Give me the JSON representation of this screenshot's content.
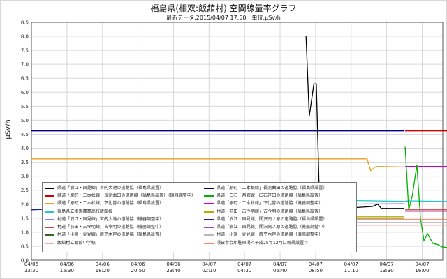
{
  "chart_data": {
    "type": "line",
    "title": "福島県(相双:飯舘村) 空間線量率グラフ",
    "subtitle": "最新データ:2015/04/07 17:50　単位:μSv/h",
    "ylabel": "μSv/h",
    "xlabel": "",
    "ylim": [
      0,
      8.5
    ],
    "yticks": [
      "0.0",
      "0.5",
      "1.0",
      "1.5",
      "2.0",
      "2.5",
      "3.0",
      "3.5",
      "4.0",
      "4.5",
      "5.0",
      "5.5",
      "6.0",
      "6.5",
      "7.0",
      "7.5",
      "8.0",
      "8.5"
    ],
    "xticks": [
      {
        "date": "04/06",
        "time": "13:30"
      },
      {
        "date": "04/06",
        "time": "15:30"
      },
      {
        "date": "04/06",
        "time": "18:20"
      },
      {
        "date": "04/06",
        "time": "20:50"
      },
      {
        "date": "04/06",
        "time": "23:40"
      },
      {
        "date": "04/07",
        "time": "02:10"
      },
      {
        "date": "04/07",
        "time": "04:30"
      },
      {
        "date": "04/07",
        "time": "06:40"
      },
      {
        "date": "04/07",
        "time": "08:50"
      },
      {
        "date": "04/07",
        "time": "11:10"
      },
      {
        "date": "04/07",
        "time": "13:30"
      },
      {
        "date": "04/07",
        "time": "16:00"
      }
    ],
    "grid": true,
    "legend_position": "bottom-left",
    "legend": [
      {
        "label": "県道「浪江・国見線」宮内大池の道路脇（福島県設置）",
        "color": "#000000"
      },
      {
        "label": "県道「原町・二本松線」長泥曲田の道路脇（福島県設置）",
        "color": "#000080"
      },
      {
        "label": "県道「原町・二本松線」長泥曲田の道路脇（福島県設置）（機器調整中）",
        "color": "#cc0000"
      },
      {
        "label": "県道「白石・月舘線」臼石笹田の道路脇（福島県設置）",
        "color": "#00b000"
      },
      {
        "label": "県道「原町・二本松線」下比曽の道路脇（福島県設置）",
        "color": "#e8a020"
      },
      {
        "label": "県道「原町・二本松線」下比曽の道路脇（機器調整中）",
        "color": "#cc00cc"
      },
      {
        "label": "福島県立相馬農業高校飯舘校",
        "color": "#20c8c8"
      },
      {
        "label": "村道「前田・古今明線」古今明の道路脇（福島県設置）",
        "color": "#b0b000"
      },
      {
        "label": "村道「浪江・国見線」宮内大池の道路脇（機器調整中）",
        "color": "#8080ff"
      },
      {
        "label": "県道「浪江・国見線」関沢南ノ原の道路脇（福島県設置）",
        "color": "#2020a0"
      },
      {
        "label": "村道「前田・古今明線」古今明の道路脇（機器調整中）",
        "color": "#d04040"
      },
      {
        "label": "県道「浪江・国見線」関沢南ノ原の道路脇（機器調整中）",
        "color": "#a040d0"
      },
      {
        "label": "村道「小宮・夏見線」蕨平木戸の道路脇（福島県設置）",
        "color": "#406020"
      },
      {
        "label": "村道「小宮・夏見線」蕨平木戸の道路脇（機器調整中）",
        "color": "#b8b8b8"
      },
      {
        "label": "飯舘村立飯舘中学校",
        "color": "#ffaaaa"
      },
      {
        "label": "浸日参会所駐車場＜平成25年12月に新規設置＞",
        "color": "#ff8060"
      }
    ],
    "series": [
      {
        "color": "#000080",
        "points": [
          [
            0,
            4.62
          ],
          [
            10.5,
            4.62
          ]
        ]
      },
      {
        "color": "#cc0000",
        "points": [
          [
            10.52,
            4.62
          ],
          [
            11.7,
            4.62
          ]
        ]
      },
      {
        "color": "#e8a020",
        "points": [
          [
            0,
            3.62
          ],
          [
            9.45,
            3.62
          ],
          [
            9.55,
            3.2
          ],
          [
            9.7,
            3.35
          ],
          [
            10.5,
            3.33
          ]
        ]
      },
      {
        "color": "#cc00cc",
        "points": [
          [
            10.52,
            3.35
          ],
          [
            11.7,
            3.35
          ]
        ]
      },
      {
        "color": "#000000",
        "points": [
          [
            7.73,
            8.0
          ],
          [
            7.82,
            5.15
          ],
          [
            7.95,
            6.3
          ],
          [
            8.02,
            6.3
          ],
          [
            8.1,
            2.5
          ],
          [
            8.3,
            1.85
          ],
          [
            9.0,
            1.87
          ],
          [
            9.6,
            1.92
          ],
          [
            9.75,
            2.0
          ],
          [
            9.85,
            1.85
          ],
          [
            10.5,
            1.85
          ]
        ]
      },
      {
        "color": "#20c8c8",
        "points": [
          [
            8.2,
            2.15
          ],
          [
            10.5,
            2.1
          ],
          [
            10.6,
            2.12
          ],
          [
            11.7,
            2.1
          ]
        ]
      },
      {
        "color": "#00b000",
        "points": [
          [
            10.52,
            4.05
          ],
          [
            10.62,
            1.8
          ],
          [
            10.72,
            2.3
          ],
          [
            10.85,
            3.4
          ],
          [
            10.95,
            1.5
          ],
          [
            11.05,
            0.7
          ],
          [
            11.15,
            0.95
          ],
          [
            11.3,
            0.6
          ],
          [
            11.45,
            0.55
          ],
          [
            11.55,
            0.48
          ],
          [
            11.7,
            0.45
          ]
        ]
      },
      {
        "color": "#8080ff",
        "points": [
          [
            8.2,
            2.0
          ],
          [
            10.5,
            2.02
          ]
        ]
      },
      {
        "color": "#2020a0",
        "points": [
          [
            0,
            1.8
          ],
          [
            1.0,
            1.85
          ]
        ]
      },
      {
        "color": "#d04040",
        "points": [
          [
            10.52,
            1.8
          ],
          [
            11.7,
            1.8
          ]
        ]
      },
      {
        "color": "#a040d0",
        "points": [
          [
            10.52,
            1.75
          ],
          [
            11.7,
            1.75
          ]
        ]
      },
      {
        "color": "#b0b000",
        "points": [
          [
            8.2,
            1.55
          ],
          [
            10.5,
            1.55
          ]
        ]
      },
      {
        "color": "#406020",
        "points": [
          [
            8.2,
            1.5
          ],
          [
            10.5,
            1.5
          ]
        ]
      },
      {
        "color": "#b8b8b8",
        "points": [
          [
            8.2,
            1.35
          ],
          [
            11.7,
            1.35
          ]
        ]
      },
      {
        "color": "#ffaaaa",
        "points": [
          [
            8.2,
            1.25
          ],
          [
            11.7,
            1.25
          ]
        ]
      },
      {
        "color": "#ff8060",
        "points": [
          [
            8.2,
            1.45
          ],
          [
            11.7,
            1.45
          ]
        ]
      }
    ]
  }
}
